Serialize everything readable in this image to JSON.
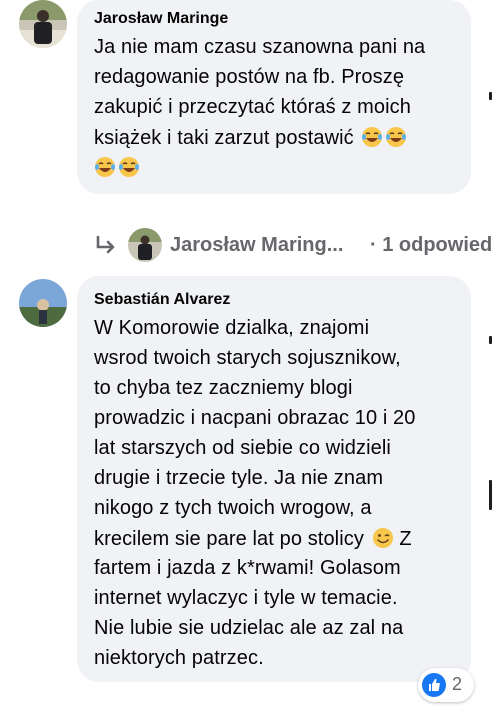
{
  "comment1": {
    "author": "Jarosław Maringe",
    "lines": [
      "Ja nie mam czasu szanowna pani na",
      "redagowanie postów na fb. Proszę",
      "zakupić i przeczytać któraś z moich",
      "książek i taki zarzut postawić"
    ],
    "trailing_emoji": [
      "laughing-tears-emoji",
      "laughing-tears-emoji",
      "laughing-tears-emoji",
      "laughing-tears-emoji"
    ]
  },
  "reply_thread": {
    "name": "Jarosław Maring...",
    "count": "· 1 odpowiedź"
  },
  "comment2": {
    "author": "Sebastián Alvarez",
    "lines": [
      "W Komorowie dzialka, znajomi",
      "wsrod twoich starych sojusznikow,",
      "to chyba tez zaczniemy blogi",
      "prowadzic i nacpani obrazac 10 i 20",
      "lat starszych od siebie co widzieli",
      "drugie i trzecie tyle. Ja nie znam",
      "nikogo z tych twoich wrogow, a",
      "krecilem sie pare lat po stolicy",
      "fartem i jazda z k*rwami! Golasom",
      "internet wylaczyc i tyle w temacie.",
      "Nie lubie sie udzielac ale az zal na",
      "niektorych patrzec."
    ],
    "line8_suffix": "Z",
    "reaction_count": "2"
  },
  "colors": {
    "bubble": "#f0f2f5",
    "secondary_text": "#65676b",
    "like_blue": "#1877f2"
  }
}
